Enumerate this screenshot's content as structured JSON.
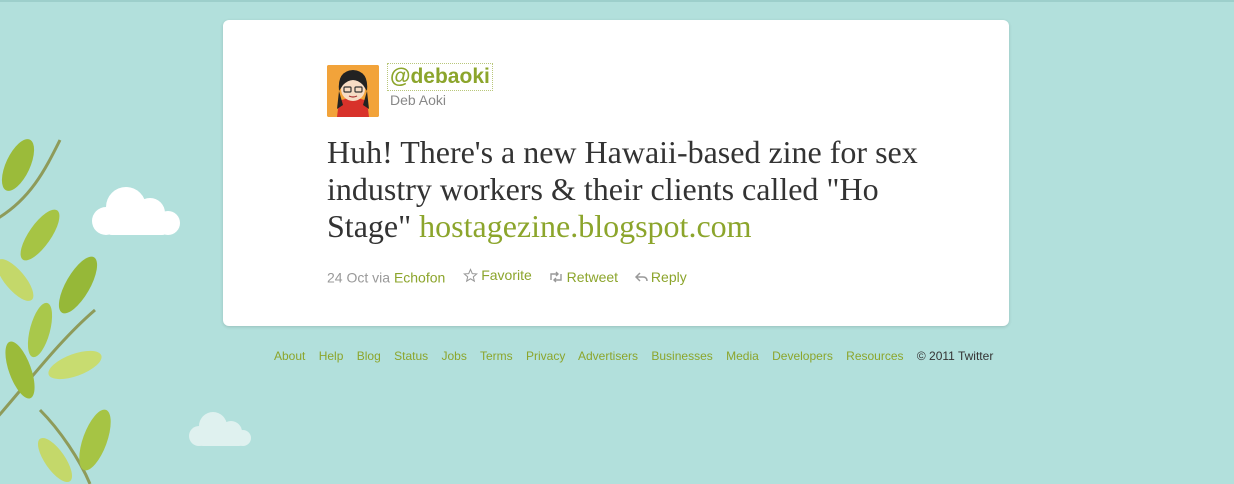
{
  "colors": {
    "background": "#b2e0dc",
    "link": "#8ca52c",
    "text": "#333333",
    "muted": "#999999"
  },
  "tweet": {
    "handle": "@debaoki",
    "name": "Deb Aoki",
    "text_plain": "Huh! There's a new Hawaii-based zine for sex industry workers & their clients called \"Ho Stage\"",
    "link": "hostagezine.blogspot.com",
    "date": "24 Oct",
    "via_label": "via",
    "source": "Echofon",
    "actions": {
      "favorite": "Favorite",
      "retweet": "Retweet",
      "reply": "Reply"
    }
  },
  "footer": {
    "links": [
      "About",
      "Help",
      "Blog",
      "Status",
      "Jobs",
      "Terms",
      "Privacy",
      "Advertisers",
      "Businesses",
      "Media",
      "Developers",
      "Resources"
    ],
    "copyright": "© 2011 Twitter"
  }
}
